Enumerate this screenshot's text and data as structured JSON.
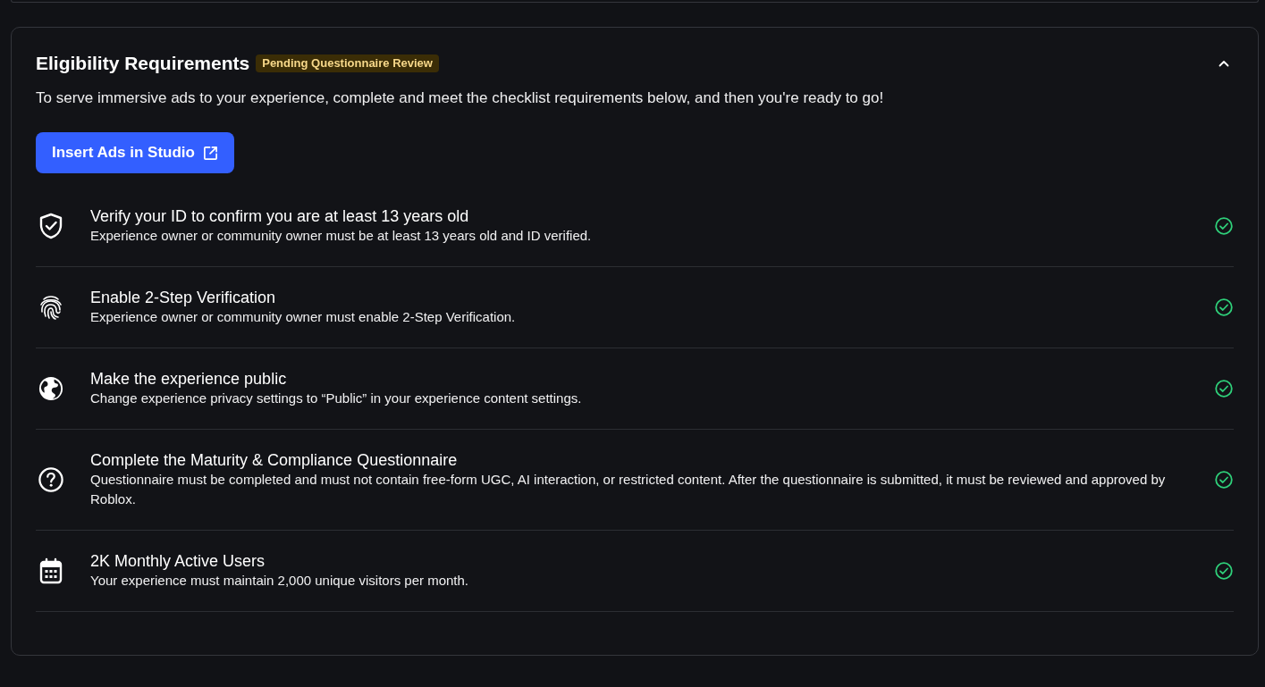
{
  "panel": {
    "title": "Eligibility Requirements",
    "badge": "Pending Questionnaire Review",
    "expanded": true,
    "description": "To serve immersive ads to your experience, complete and meet the checklist requirements below, and then you're ready to go!",
    "action_button": "Insert Ads in Studio",
    "requirements": [
      {
        "kind": "shield",
        "title": "Verify your ID to confirm you are at least 13 years old",
        "description": "Experience owner or community owner must be at least 13 years old and ID verified.",
        "met": true
      },
      {
        "kind": "fingerprint",
        "title": "Enable 2-Step Verification",
        "description": "Experience owner or community owner must enable 2-Step Verification.",
        "met": true
      },
      {
        "kind": "globe",
        "title": "Make the experience public",
        "description": "Change experience privacy settings to “Public” in your experience content settings.",
        "met": true
      },
      {
        "kind": "question",
        "title": "Complete the Maturity & Compliance Questionnaire",
        "description": "Questionnaire must be completed and must not contain free-form UGC, AI interaction, or restricted content. After the questionnaire is submitted, it must be reviewed and approved by Roblox.",
        "met": true
      },
      {
        "kind": "calendar",
        "title": "2K Monthly Active Users",
        "description": "Your experience must maintain 2,000 unique visitors per month.",
        "met": true
      }
    ]
  }
}
